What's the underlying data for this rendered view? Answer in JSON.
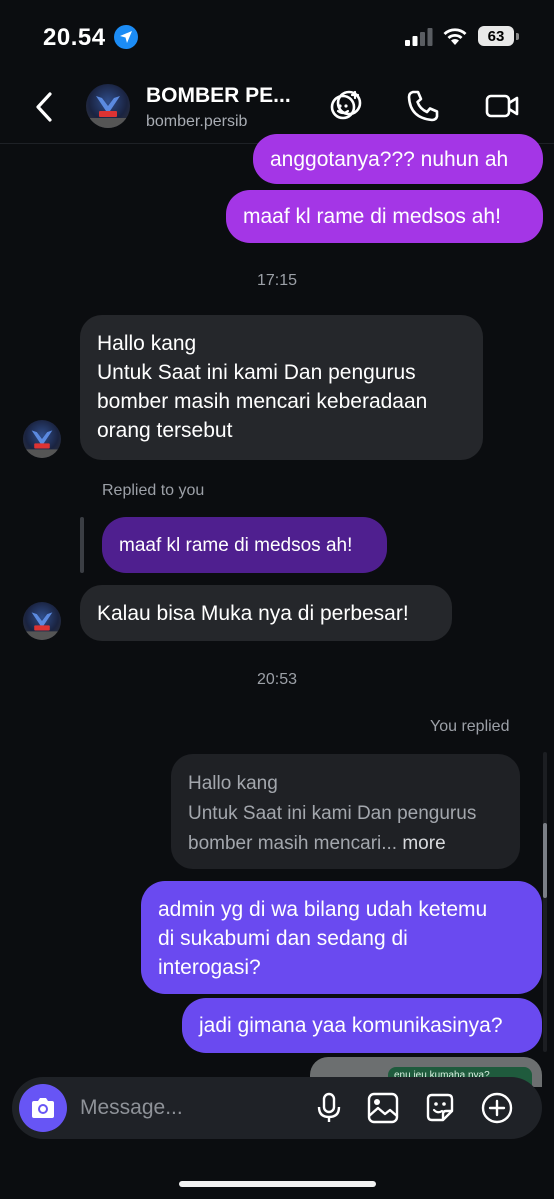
{
  "status_bar": {
    "time": "20.54",
    "battery": "63"
  },
  "header": {
    "title": "BOMBER PE...",
    "handle": "bomber.persib"
  },
  "messages": {
    "out_1": "anggotanya??? nuhun ah",
    "out_2": "maaf kl rame di medsos ah!",
    "time_1": "17:15",
    "in_1_lines": [
      "Hallo kang",
      "Untuk Saat ini kami Dan pengurus",
      "bomber masih mencari keberadaan",
      "orang tersebut"
    ],
    "replied_note": "Replied to you",
    "replied_quote": "maaf kl rame di medsos ah!",
    "in_2": "Kalau bisa Muka nya di perbesar!",
    "time_2": "20:53",
    "you_replied_note": "You replied",
    "quoted_lines": [
      "Hallo kang",
      "Untuk Saat ini kami Dan pengurus",
      "bomber masih mencari..."
    ],
    "quoted_more": "more",
    "out_3_lines": [
      "admin yg di wa bilang udah ketemu",
      "di sukabumi dan sedang di",
      "interogasi?"
    ],
    "out_4": "jadi gimana yaa komunikasinya?",
    "photo_peek_text": "enu jeu kumaha nya?"
  },
  "composer": {
    "placeholder": "Message..."
  },
  "colors": {
    "outgoing": "#a436e6",
    "outgoing_alt": "#6a4af0",
    "incoming": "#25272b",
    "camera_button": "#6755f5"
  },
  "icons": [
    "location-arrow-icon",
    "signal-icon",
    "wifi-icon",
    "back-chevron-icon",
    "effects-icon",
    "phone-icon",
    "video-icon",
    "camera-icon",
    "microphone-icon",
    "gallery-icon",
    "sticker-icon",
    "plus-icon"
  ]
}
